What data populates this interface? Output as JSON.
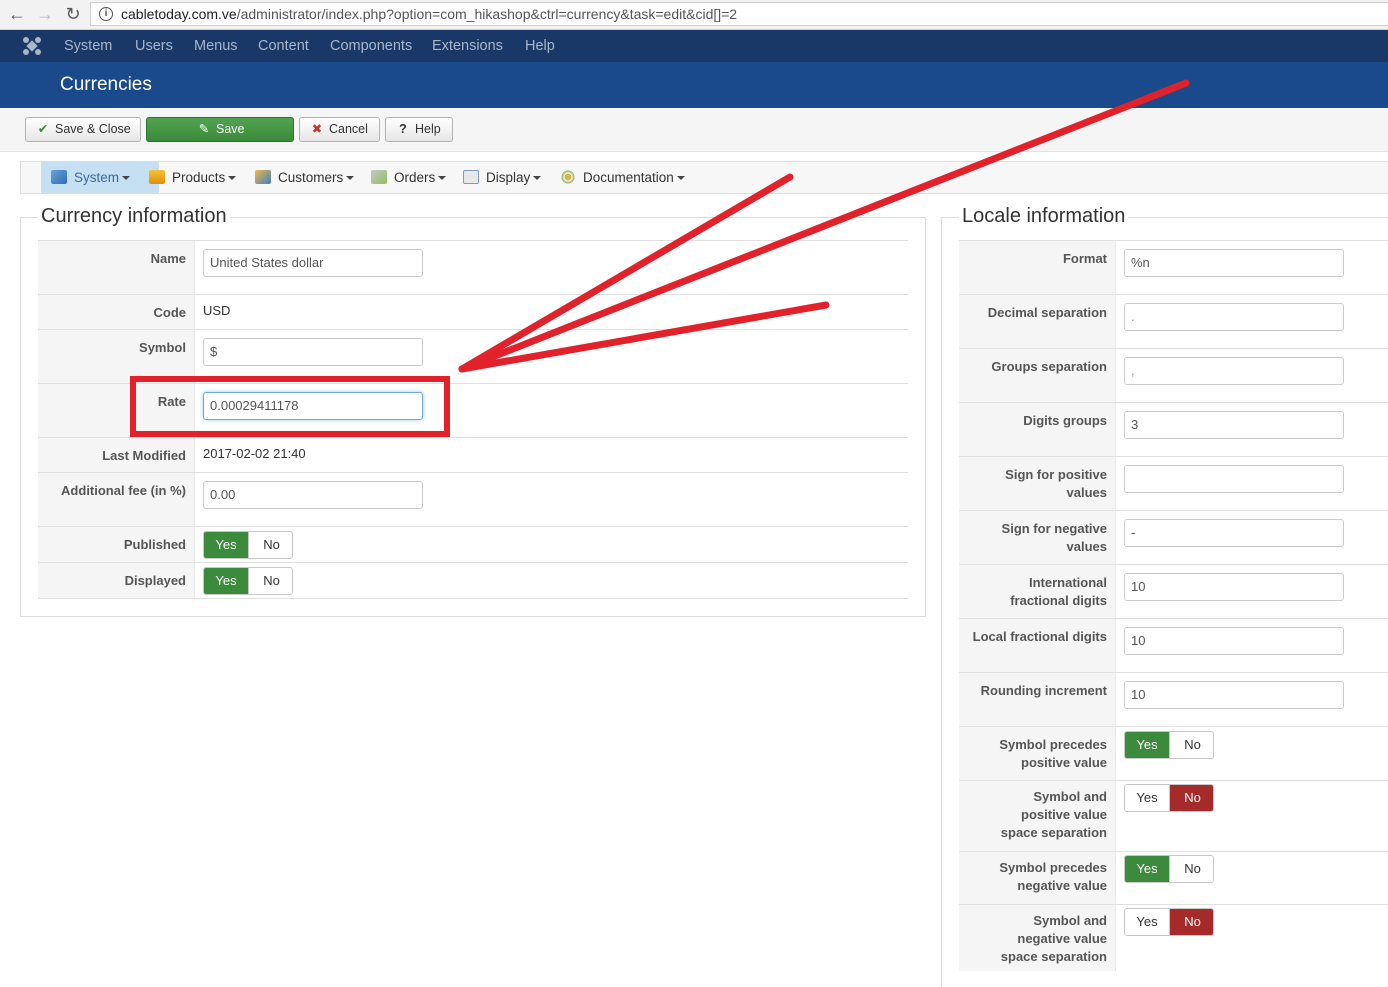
{
  "browser": {
    "url_host": "cabletoday.com.ve",
    "url_path": "/administrator/index.php?option=com_hikashop&ctrl=currency&task=edit&cid[]=2"
  },
  "admin_menu": [
    "System",
    "Users",
    "Menus",
    "Content",
    "Components",
    "Extensions",
    "Help"
  ],
  "page_title": "Currencies",
  "toolbar": {
    "save_close": "Save & Close",
    "save": "Save",
    "cancel": "Cancel",
    "help": "Help"
  },
  "hika_menu": [
    "System",
    "Products",
    "Customers",
    "Orders",
    "Display",
    "Documentation"
  ],
  "currency": {
    "legend": "Currency information",
    "name_label": "Name",
    "name_value": "United States dollar",
    "code_label": "Code",
    "code_value": "USD",
    "symbol_label": "Symbol",
    "symbol_value": "$",
    "rate_label": "Rate",
    "rate_value": "0.00029411178",
    "modified_label": "Last Modified",
    "modified_value": "2017-02-02 21:40",
    "fee_label": "Additional fee (in %)",
    "fee_value": "0.00",
    "published_label": "Published",
    "displayed_label": "Displayed",
    "yes": "Yes",
    "no": "No",
    "published_state": "Yes",
    "displayed_state": "Yes"
  },
  "locale": {
    "legend": "Locale information",
    "format_label": "Format",
    "format_value": "%n",
    "decimal_label": "Decimal separation",
    "decimal_value": ".",
    "groups_label": "Groups separation",
    "groups_value": ",",
    "digits_groups_label": "Digits groups",
    "digits_groups_value": "3",
    "sign_pos_label": "Sign for positive values",
    "sign_pos_value": "",
    "sign_neg_label": "Sign for negative values",
    "sign_neg_value": "-",
    "intl_frac_label": "International fractional digits",
    "intl_frac_value": "10",
    "local_frac_label": "Local fractional digits",
    "local_frac_value": "10",
    "rounding_label": "Rounding increment",
    "rounding_value": "10",
    "sym_prec_pos_label": "Symbol precedes positive value",
    "sym_prec_pos_state": "Yes",
    "sym_space_pos_label": "Symbol and positive value space separation",
    "sym_space_pos_state": "No",
    "sym_prec_neg_label": "Symbol precedes negative value",
    "sym_prec_neg_state": "Yes",
    "sym_space_neg_label": "Symbol and negative value space separation",
    "sym_space_neg_state": "No"
  },
  "colors": {
    "header_bg": "#1b4a8c",
    "admin_menu_bg": "#1a3867",
    "yes_green": "#3c8a3c",
    "no_red": "#a52a2a",
    "annotation_red": "#e2222b"
  }
}
